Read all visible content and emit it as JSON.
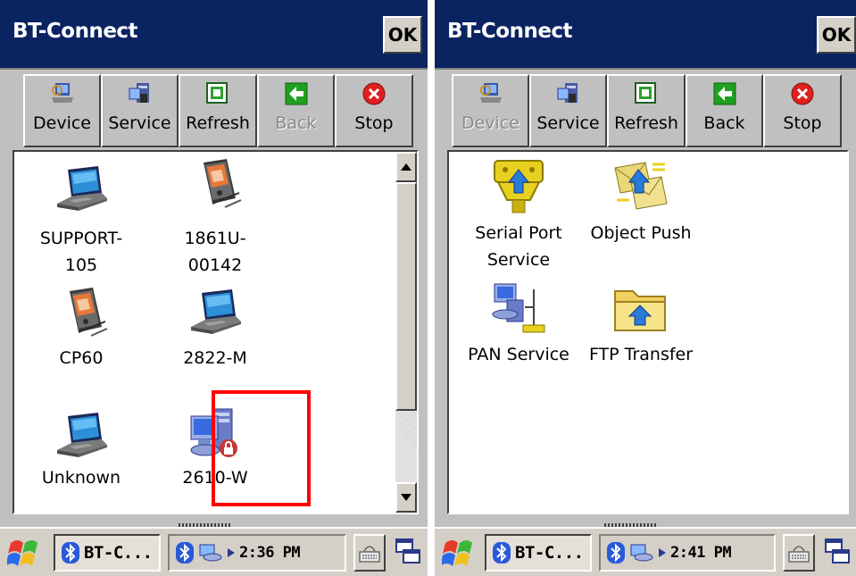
{
  "left": {
    "window_title": "BT-Connect",
    "ok_label": "OK",
    "toolbar": [
      {
        "label": "Device",
        "icon": "device-search-icon",
        "enabled": true
      },
      {
        "label": "Service",
        "icon": "service-icon",
        "enabled": true
      },
      {
        "label": "Refresh",
        "icon": "refresh-icon",
        "enabled": true
      },
      {
        "label": "Back",
        "icon": "back-arrow-icon",
        "enabled": false
      },
      {
        "label": "Stop",
        "icon": "stop-icon",
        "enabled": true
      }
    ],
    "devices": [
      {
        "name": "SUPPORT-\n105",
        "icon": "laptop-icon"
      },
      {
        "name": "1861U-\n00142",
        "icon": "handheld-icon"
      },
      {
        "name": "CP60",
        "icon": "handheld-icon"
      },
      {
        "name": "2822-M",
        "icon": "laptop-icon"
      },
      {
        "name": "Unknown",
        "icon": "laptop-icon"
      },
      {
        "name": "2610-W",
        "icon": "computer-locked-icon"
      }
    ],
    "taskbar": {
      "task_label": "BT-C...",
      "clock": "2:36 PM"
    }
  },
  "right": {
    "window_title": "BT-Connect",
    "ok_label": "OK",
    "toolbar": [
      {
        "label": "Device",
        "icon": "device-search-icon",
        "enabled": false
      },
      {
        "label": "Service",
        "icon": "service-icon",
        "enabled": true
      },
      {
        "label": "Refresh",
        "icon": "refresh-icon",
        "enabled": true
      },
      {
        "label": "Back",
        "icon": "back-arrow-icon",
        "enabled": true
      },
      {
        "label": "Stop",
        "icon": "stop-icon",
        "enabled": true
      }
    ],
    "services": [
      {
        "name": "Serial Port\nService",
        "icon": "serial-port-icon"
      },
      {
        "name": "Object Push",
        "icon": "object-push-icon"
      },
      {
        "name": "PAN Service",
        "icon": "pan-network-icon"
      },
      {
        "name": "FTP Transfer",
        "icon": "ftp-folder-icon"
      }
    ],
    "taskbar": {
      "task_label": "BT-C...",
      "clock": "2:41 PM"
    }
  },
  "colors": {
    "titlebar": "#0a2462",
    "highlight": "#ff0000",
    "chrome": "#c0c0c0"
  }
}
